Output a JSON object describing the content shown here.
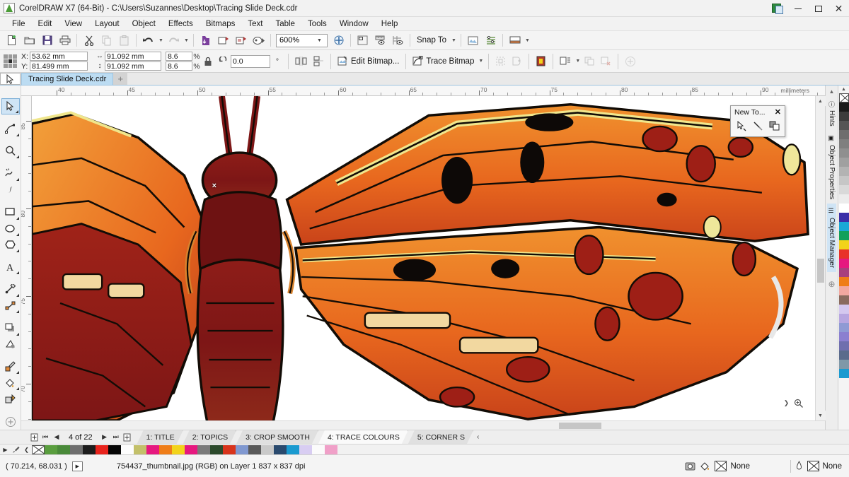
{
  "window": {
    "title": "CorelDRAW X7 (64-Bit) - C:\\Users\\Suzannes\\Desktop\\Tracing Slide Deck.cdr",
    "logo_icon": "coreldraw-logo-icon",
    "controls": [
      {
        "name": "restore-down-button",
        "icon": "restore-icon",
        "glyph": ""
      },
      {
        "name": "minimize-button",
        "icon": "minimize-icon",
        "glyph": ""
      },
      {
        "name": "maximize-button",
        "icon": "maximize-icon",
        "glyph": ""
      },
      {
        "name": "close-button",
        "icon": "close-icon",
        "glyph": "✕"
      }
    ]
  },
  "menubar": {
    "items": [
      {
        "label": "File"
      },
      {
        "label": "Edit"
      },
      {
        "label": "View"
      },
      {
        "label": "Layout"
      },
      {
        "label": "Object"
      },
      {
        "label": "Effects"
      },
      {
        "label": "Bitmaps"
      },
      {
        "label": "Text"
      },
      {
        "label": "Table"
      },
      {
        "label": "Tools"
      },
      {
        "label": "Window"
      },
      {
        "label": "Help"
      }
    ]
  },
  "toolbar": {
    "buttons": [
      {
        "name": "new-document-button",
        "icon": "new-document-icon"
      },
      {
        "name": "open-document-button",
        "icon": "open-folder-icon"
      },
      {
        "name": "save-button",
        "icon": "save-disk-icon"
      },
      {
        "name": "print-button",
        "icon": "printer-icon"
      },
      {
        "name": "cut-button",
        "icon": "scissors-icon"
      },
      {
        "name": "copy-button",
        "icon": "copy-icon"
      },
      {
        "name": "paste-button",
        "icon": "paste-icon"
      },
      {
        "name": "undo-button",
        "icon": "undo-arrow-icon"
      },
      {
        "name": "redo-button",
        "icon": "redo-arrow-icon"
      },
      {
        "name": "import-button",
        "icon": "import-icon"
      },
      {
        "name": "export-button",
        "icon": "export-icon"
      },
      {
        "name": "publish-pdf-button",
        "icon": "publish-pdf-icon"
      },
      {
        "name": "corel-connect-button",
        "icon": "corel-connect-icon"
      }
    ],
    "zoom_level": "600%",
    "zoom_placeholder": "600%",
    "zoom_levels_button": "zoom-levels-icon",
    "view_buttons": [
      {
        "name": "full-screen-preview-button",
        "icon": "preview-icon"
      },
      {
        "name": "show-hide-rulers-button",
        "icon": "show-rulers-icon"
      },
      {
        "name": "show-hide-grid-button",
        "icon": "show-grid-icon"
      }
    ],
    "snap_to_label": "Snap To",
    "options_buttons": [
      {
        "name": "options-button",
        "icon": "options-icon"
      },
      {
        "name": "object-styles-button",
        "icon": "object-styles-icon"
      },
      {
        "name": "application-launcher-button",
        "icon": "app-launcher-icon"
      }
    ]
  },
  "propertybar": {
    "x_label": "X:",
    "y_label": "Y:",
    "x_value": "53.62 mm",
    "y_value": "81.499 mm",
    "width_value": "91.092 mm",
    "height_value": "91.092 mm",
    "scale_w": "8.6",
    "scale_h": "8.6",
    "percent_symbol": "%",
    "lock_ratio_icon": "lock-icon",
    "rotation_value": "0.0",
    "degree_symbol": "°",
    "rotation_placeholder": "0.0",
    "buttons": [
      {
        "name": "mirror-horizontal-button",
        "icon": "mirror-horizontal-icon"
      },
      {
        "name": "mirror-vertical-button",
        "icon": "mirror-vertical-icon"
      },
      {
        "name": "edit-bitmap-button",
        "label": "Edit Bitmap...",
        "icon": "edit-bitmap-icon"
      },
      {
        "name": "trace-bitmap-button",
        "label": "Trace Bitmap",
        "icon": "trace-bitmap-icon"
      },
      {
        "name": "crop-bitmap-button",
        "icon": "crop-bitmap-icon"
      },
      {
        "name": "shape-bitmap-button",
        "icon": "shape-bitmap-icon"
      },
      {
        "name": "bitmap-color-mask-button",
        "icon": "color-mask-icon"
      },
      {
        "name": "wrap-text-button",
        "icon": "wrap-text-icon"
      },
      {
        "name": "duplicate-button",
        "icon": "duplicate-icon"
      },
      {
        "name": "delete-button",
        "icon": "delete-icon"
      },
      {
        "name": "add-button",
        "icon": "plus-circle-icon"
      }
    ]
  },
  "documenttabs": {
    "active_tool_icon": "pick-tool-icon",
    "tabs": [
      {
        "label": "Tracing Slide Deck.cdr",
        "active": true
      }
    ],
    "new_tab_label": "+"
  },
  "toolbox": {
    "tools": [
      {
        "name": "pick-tool",
        "icon": "pick-tool-icon",
        "selected": true,
        "flyout": true
      },
      {
        "name": "shape-tool",
        "icon": "shape-node-icon",
        "flyout": true
      },
      {
        "name": "zoom-tool",
        "icon": "magnifier-icon",
        "flyout": true
      },
      {
        "name": "freehand-tool",
        "icon": "freehand-curve-icon",
        "flyout": true
      },
      {
        "name": "artistic-media-tool",
        "icon": "artistic-media-icon",
        "flyout": false
      },
      {
        "name": "rectangle-tool",
        "icon": "rectangle-icon",
        "flyout": true
      },
      {
        "name": "ellipse-tool",
        "icon": "ellipse-icon",
        "flyout": true
      },
      {
        "name": "polygon-tool",
        "icon": "polygon-icon",
        "flyout": true
      },
      {
        "name": "text-tool",
        "icon": "text-a-icon",
        "flyout": true
      },
      {
        "name": "parallel-dimension-tool",
        "icon": "dimension-icon",
        "flyout": true
      },
      {
        "name": "straight-line-connector-tool",
        "icon": "connector-icon",
        "flyout": true
      },
      {
        "name": "drop-shadow-tool",
        "icon": "drop-shadow-icon",
        "flyout": true
      },
      {
        "name": "transparency-tool",
        "icon": "transparency-icon",
        "flyout": false
      },
      {
        "name": "color-eyedropper-tool",
        "icon": "eyedropper-icon",
        "flyout": true
      },
      {
        "name": "interactive-fill-tool",
        "icon": "fill-bucket-icon",
        "flyout": true
      },
      {
        "name": "outline-tool",
        "icon": "outline-pen-icon",
        "flyout": false
      },
      {
        "name": "quick-customize-tool",
        "icon": "plus-circle-icon",
        "flyout": false
      }
    ]
  },
  "rulers": {
    "unit_label": "millimeters",
    "horizontal_ticks": [
      "40",
      "45",
      "50",
      "55",
      "60",
      "65",
      "70",
      "75",
      "80",
      "85",
      "90"
    ],
    "vertical_ticks": [
      "85",
      "80",
      "75",
      "70"
    ]
  },
  "newtool_palette": {
    "title": "New To...",
    "close_icon": "close-icon",
    "buttons": [
      {
        "name": "smart-drawing-tool-button",
        "icon": "smart-drawing-icon"
      },
      {
        "name": "knife-tool-button",
        "icon": "knife-icon"
      },
      {
        "name": "shape-builder-button",
        "icon": "shape-builder-icon"
      }
    ]
  },
  "dockers": {
    "tabs": [
      {
        "label": "Hints",
        "icon": "hints-icon",
        "active": false
      },
      {
        "label": "Object Properties",
        "icon": "object-properties-icon",
        "active": false
      },
      {
        "label": "Object Manager",
        "icon": "object-manager-icon",
        "active": true
      }
    ],
    "add_docker_icon": "plus-circle-icon"
  },
  "pagebar": {
    "add_page_start_icon": "add-page-icon",
    "first_icon": "first-page-icon",
    "prev_icon": "prev-page-icon",
    "counter": "4 of 22",
    "next_icon": "next-page-icon",
    "last_icon": "last-page-icon",
    "add_page_end_icon": "add-page-icon",
    "tabs": [
      {
        "label": "1: TITLE",
        "active": false
      },
      {
        "label": "2: TOPICS",
        "active": false
      },
      {
        "label": "3: CROP SMOOTH",
        "active": false
      },
      {
        "label": "4: TRACE COLOURS",
        "active": true
      },
      {
        "label": "5: CORNER S",
        "active": false
      }
    ],
    "overflow_label": "‹"
  },
  "statusbar": {
    "cursor_position": "( 70.214, 68.031 )",
    "object_info": "754437_thumbnail.jpg (RGB) on Layer 1 837 x 837 dpi",
    "fill_icon": "fill-bucket-icon",
    "fill_value": "None",
    "outline_icon": "outline-pen-icon",
    "outline_value": "None",
    "snapshot_icon": "snapshot-icon",
    "none_swatch_icon": "no-color-x-icon"
  },
  "colors": {
    "accent": "#cfe4f5",
    "tab_active": "#bcdcf2",
    "artwork_orange": "#e8671e",
    "artwork_deep_red": "#9e2318",
    "artwork_maroon": "#7d1616",
    "artwork_yellow": "#f0e68c",
    "artwork_outline": "#120c06",
    "palette_vertical": [
      "none",
      "#1a1a1a",
      "#3c3c3c",
      "#555555",
      "#6e6e6e",
      "#7f7f7f",
      "#8f8f8f",
      "#a0a0a0",
      "#b3b3b3",
      "#c6c6c6",
      "#d9d9d9",
      "#ececec",
      "#ffffff",
      "#3b2fa8",
      "#1aa8d6",
      "#12a05a",
      "#f2d31b",
      "#e8322a",
      "#e6187f",
      "#a8407e",
      "#ef7d18",
      "#f2a8a0",
      "#8a6b5e",
      "#d4c8ef",
      "#b7a6e0",
      "#8f9ad4",
      "#8b7fd0",
      "#6f6fae",
      "#5a6b8c",
      "#7f98a8",
      "#1a9ad0"
    ],
    "palette_horizontal": [
      "none",
      "#5a9e3f",
      "#4a8a3a",
      "#6e6e6e",
      "#1c1c1c",
      "#e8231c",
      "#060606",
      "#fdfdfd",
      "#c3c06a",
      "#e6187f",
      "#ef7d18",
      "#f2d31b",
      "#e6187f",
      "#7a7a7a",
      "#2c4a2c",
      "#d8341c",
      "#8098d0",
      "#5a5a5a",
      "#c9c9c9",
      "#2a4a6e",
      "#1a9ad0",
      "#d8cdf2",
      "#fbfbfb",
      "#f0a0c8"
    ]
  },
  "canvas": {
    "artwork_name": "traced-butterfly-artwork",
    "anchor_marker": "×",
    "zoom_controls": [
      {
        "name": "canvas-zoom-out-button",
        "icon": "zoom-out-icon"
      },
      {
        "name": "canvas-zoom-in-button",
        "icon": "zoom-in-icon"
      }
    ]
  }
}
